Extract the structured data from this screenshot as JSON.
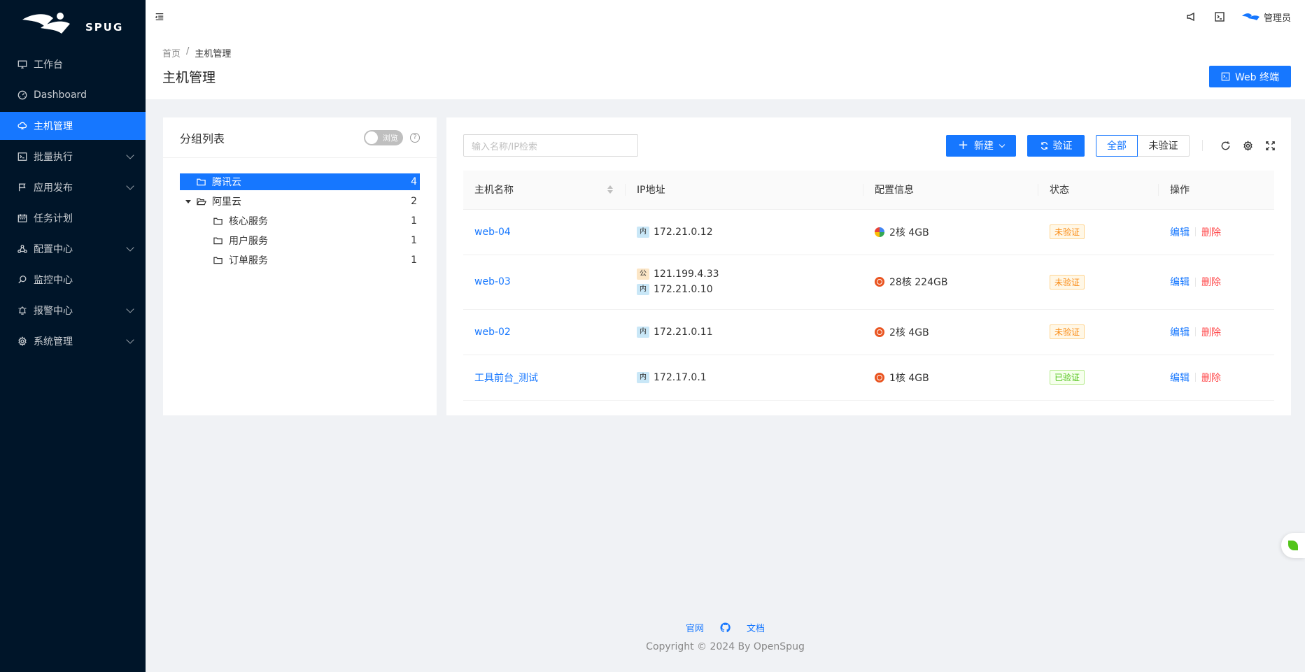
{
  "brand": {
    "name": "SPUG"
  },
  "sidebar": {
    "items": [
      {
        "label": "工作台",
        "icon": "desktop-icon",
        "expandable": false,
        "active": false
      },
      {
        "label": "Dashboard",
        "icon": "dashboard-icon",
        "expandable": false,
        "active": false
      },
      {
        "label": "主机管理",
        "icon": "cloud-server-icon",
        "expandable": false,
        "active": true
      },
      {
        "label": "批量执行",
        "icon": "code-icon",
        "expandable": true,
        "active": false
      },
      {
        "label": "应用发布",
        "icon": "flag-icon",
        "expandable": true,
        "active": false
      },
      {
        "label": "任务计划",
        "icon": "schedule-icon",
        "expandable": false,
        "active": false
      },
      {
        "label": "配置中心",
        "icon": "deployment-icon",
        "expandable": true,
        "active": false
      },
      {
        "label": "监控中心",
        "icon": "monitor-search-icon",
        "expandable": false,
        "active": false
      },
      {
        "label": "报警中心",
        "icon": "alert-icon",
        "expandable": true,
        "active": false
      },
      {
        "label": "系统管理",
        "icon": "setting-icon",
        "expandable": true,
        "active": false
      }
    ]
  },
  "header": {
    "user_name": "管理员",
    "icons": [
      "notification-icon",
      "terminal-icon"
    ]
  },
  "page": {
    "breadcrumb": [
      "首页",
      "主机管理"
    ],
    "breadcrumb_sep": "/",
    "title": "主机管理",
    "web_terminal_label": "Web 终端"
  },
  "groups": {
    "title": "分组列表",
    "toggle_label": "浏览",
    "help": "?",
    "tree": [
      {
        "label": "腾讯云",
        "count": "4",
        "selected": true,
        "level": 1,
        "expanded": false
      },
      {
        "label": "阿里云",
        "count": "2",
        "selected": false,
        "level": 1,
        "expanded": true
      },
      {
        "label": "核心服务",
        "count": "1",
        "selected": false,
        "level": 2
      },
      {
        "label": "用户服务",
        "count": "1",
        "selected": false,
        "level": 2
      },
      {
        "label": "订单服务",
        "count": "1",
        "selected": false,
        "level": 2
      }
    ]
  },
  "hosts": {
    "search_placeholder": "输入名称/IP检索",
    "new_label": "新建",
    "verify_label": "验证",
    "filter_all": "全部",
    "filter_unverified": "未验证",
    "columns": [
      "主机名称",
      "IP地址",
      "配置信息",
      "状态",
      "操作"
    ],
    "rows": [
      {
        "name": "web-04",
        "ips": [
          {
            "tag": "内",
            "ip": "172.21.0.12"
          }
        ],
        "os": "other",
        "config": "2核 4GB",
        "status": "未验证",
        "verified": false,
        "edit": "编辑",
        "delete": "删除"
      },
      {
        "name": "web-03",
        "ips": [
          {
            "tag": "公",
            "ip": "121.199.4.33"
          },
          {
            "tag": "内",
            "ip": "172.21.0.10"
          }
        ],
        "os": "ubuntu",
        "config": "28核 224GB",
        "status": "未验证",
        "verified": false,
        "edit": "编辑",
        "delete": "删除"
      },
      {
        "name": "web-02",
        "ips": [
          {
            "tag": "内",
            "ip": "172.21.0.11"
          }
        ],
        "os": "ubuntu",
        "config": "2核 4GB",
        "status": "未验证",
        "verified": false,
        "edit": "编辑",
        "delete": "删除"
      },
      {
        "name": "工具前台_测试",
        "ips": [
          {
            "tag": "内",
            "ip": "172.17.0.1"
          }
        ],
        "os": "ubuntu",
        "config": "1核 4GB",
        "status": "已验证",
        "verified": true,
        "edit": "编辑",
        "delete": "删除"
      }
    ]
  },
  "footer": {
    "links": [
      "官网",
      "文档"
    ],
    "copyright": "Copyright © 2024 By OpenSpug"
  },
  "colors": {
    "primary": "#1677ff",
    "sidebar_bg": "#001529",
    "danger": "#ff4d4f",
    "warning": "#fa8c16",
    "success": "#52c41a"
  }
}
